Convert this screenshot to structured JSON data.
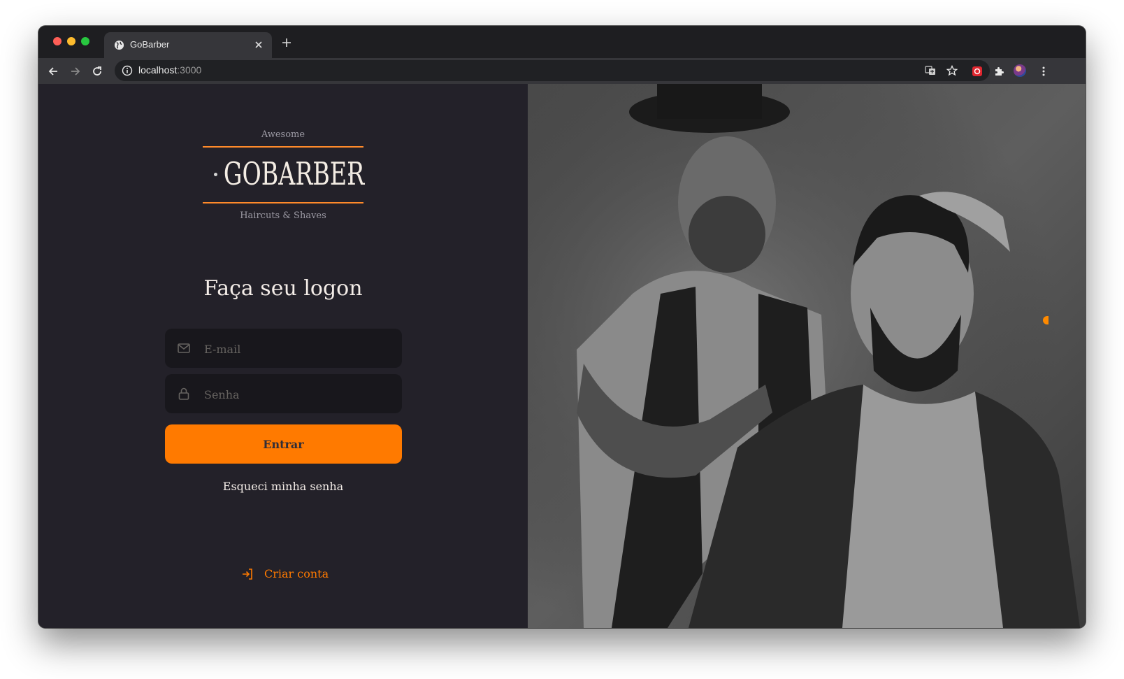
{
  "browser": {
    "tab_title": "GoBarber",
    "url_host": "localhost",
    "url_port": ":3000"
  },
  "logo": {
    "top_text": "Awesome",
    "wordmark": "GOBARBER",
    "bottom_text": "Haircuts & Shaves"
  },
  "login": {
    "heading": "Faça seu logon",
    "email_placeholder": "E-mail",
    "password_placeholder": "Senha",
    "submit_label": "Entrar",
    "forgot_label": "Esqueci minha senha",
    "create_account_label": "Criar conta"
  },
  "colors": {
    "accent": "#ff7a00",
    "background": "#232129",
    "input_background": "#18171c",
    "text": "#f4ede8"
  },
  "icons": {
    "email": "mail-icon",
    "password": "lock-icon",
    "create_account": "log-in-icon"
  }
}
